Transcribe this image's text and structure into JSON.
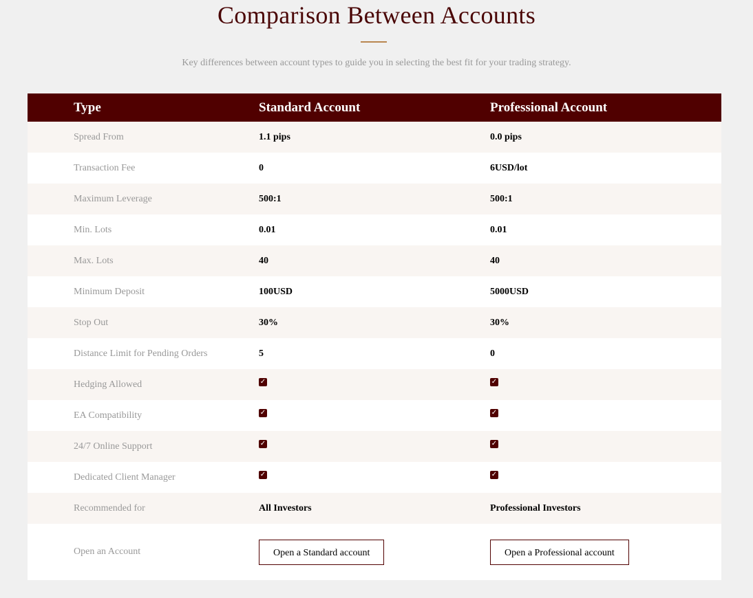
{
  "header": {
    "title": "Comparison Between Accounts",
    "subtitle": "Key differences between account types to guide you in selecting the best fit for your trading strategy."
  },
  "table": {
    "columns": [
      "Type",
      "Standard Account",
      "Professional Account"
    ],
    "rows": [
      {
        "label": "Spread From",
        "standard": "1.1 pips",
        "professional": "0.0 pips"
      },
      {
        "label": "Transaction Fee",
        "standard": "0",
        "professional": "6USD/lot"
      },
      {
        "label": "Maximum Leverage",
        "standard": "500:1",
        "professional": "500:1"
      },
      {
        "label": "Min. Lots",
        "standard": "0.01",
        "professional": "0.01"
      },
      {
        "label": "Max. Lots",
        "standard": "40",
        "professional": "40"
      },
      {
        "label": "Minimum Deposit",
        "standard": "100USD",
        "professional": "5000USD"
      },
      {
        "label": "Stop Out",
        "standard": "30%",
        "professional": "30%"
      },
      {
        "label": "Distance Limit for Pending Orders",
        "standard": "5",
        "professional": "0"
      },
      {
        "label": "Hedging Allowed",
        "standard": "✓",
        "professional": "✓"
      },
      {
        "label": "EA Compatibility",
        "standard": "✓",
        "professional": "✓"
      },
      {
        "label": "24/7 Online Support",
        "standard": "✓",
        "professional": "✓"
      },
      {
        "label": "Dedicated Client Manager",
        "standard": "✓",
        "professional": "✓"
      },
      {
        "label": "Recommended for",
        "standard": "All Investors",
        "professional": "Professional Investors"
      }
    ],
    "action_row": {
      "label": "Open an Account",
      "standard_button": "Open a Standard account",
      "professional_button": "Open a Professional account"
    }
  },
  "colors": {
    "brand": "#500000",
    "accent": "#b8864f"
  }
}
